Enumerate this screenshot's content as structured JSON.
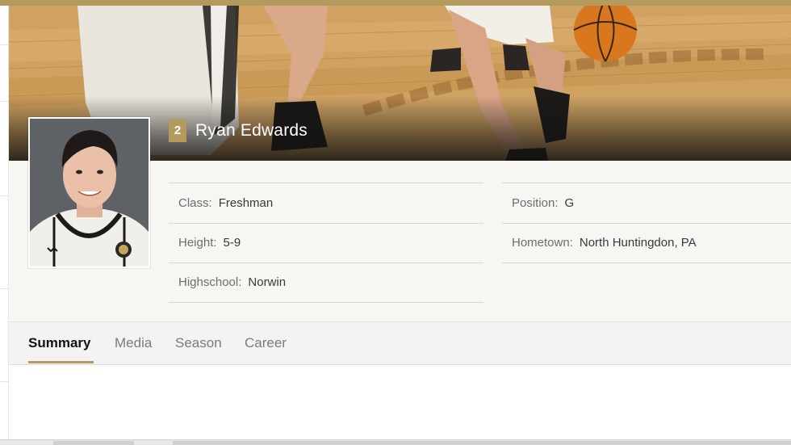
{
  "profile": {
    "number": "2",
    "name": "Ryan Edwards"
  },
  "bio": {
    "class_label": "Class:",
    "class_value": "Freshman",
    "height_label": "Height:",
    "height_value": "5-9",
    "highschool_label": "Highschool:",
    "highschool_value": "Norwin",
    "position_label": "Position:",
    "position_value": "G",
    "hometown_label": "Hometown:",
    "hometown_value": "North Huntingdon, PA"
  },
  "tabs": [
    {
      "label": "Summary",
      "active": true
    },
    {
      "label": "Media",
      "active": false
    },
    {
      "label": "Season",
      "active": false
    },
    {
      "label": "Career",
      "active": false
    }
  ],
  "colors": {
    "accent": "#b59a5e",
    "panel": "#f7f6f3",
    "tabs_bg": "#f3f3f3"
  }
}
